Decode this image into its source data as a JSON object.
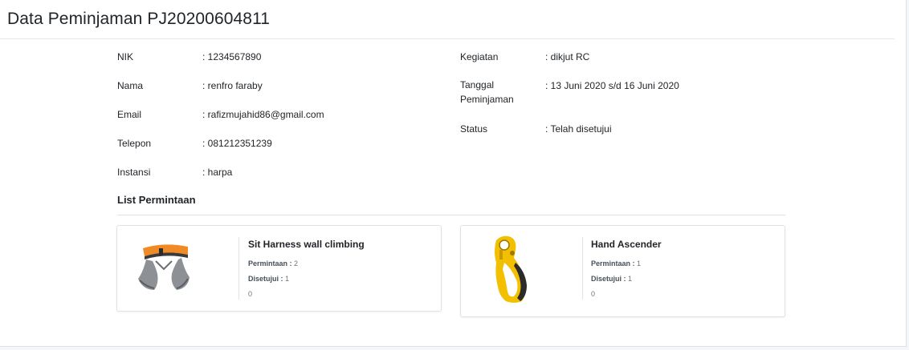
{
  "header": {
    "title": "Data Peminjaman PJ20200604811"
  },
  "borrower": {
    "nik": {
      "label": "NIK",
      "value": ": 1234567890"
    },
    "nama": {
      "label": "Nama",
      "value": ": renfro faraby"
    },
    "email": {
      "label": "Email",
      "value": ": rafizmujahid86@gmail.com"
    },
    "telepon": {
      "label": "Telepon",
      "value": ": 081212351239"
    },
    "instansi": {
      "label": "Instansi",
      "value": ": harpa"
    }
  },
  "activity": {
    "kegiatan": {
      "label": "Kegiatan",
      "value": ": dikjut RC"
    },
    "tanggal": {
      "label": "Tanggal Peminjaman",
      "value": ": 13 Juni 2020 s/d 16 Juni 2020"
    },
    "status": {
      "label": "Status",
      "value": ": Telah disetujui"
    }
  },
  "requests": {
    "title": "List Permintaan",
    "items": [
      {
        "name": "Sit Harness wall climbing",
        "permintaan_label": "Permintaan :",
        "permintaan_value": "2",
        "disetujui_label": "Disetujui :",
        "disetujui_value": "1",
        "extra": "0",
        "icon": "harness-icon"
      },
      {
        "name": "Hand Ascender",
        "permintaan_label": "Permintaan :",
        "permintaan_value": "1",
        "disetujui_label": "Disetujui :",
        "disetujui_value": "1",
        "extra": "0",
        "icon": "ascender-icon"
      }
    ]
  },
  "colors": {
    "harness_orange": "#f08a24",
    "harness_gray": "#8d9094",
    "ascender_yellow": "#f2c000",
    "ascender_black": "#2b2b2b"
  }
}
